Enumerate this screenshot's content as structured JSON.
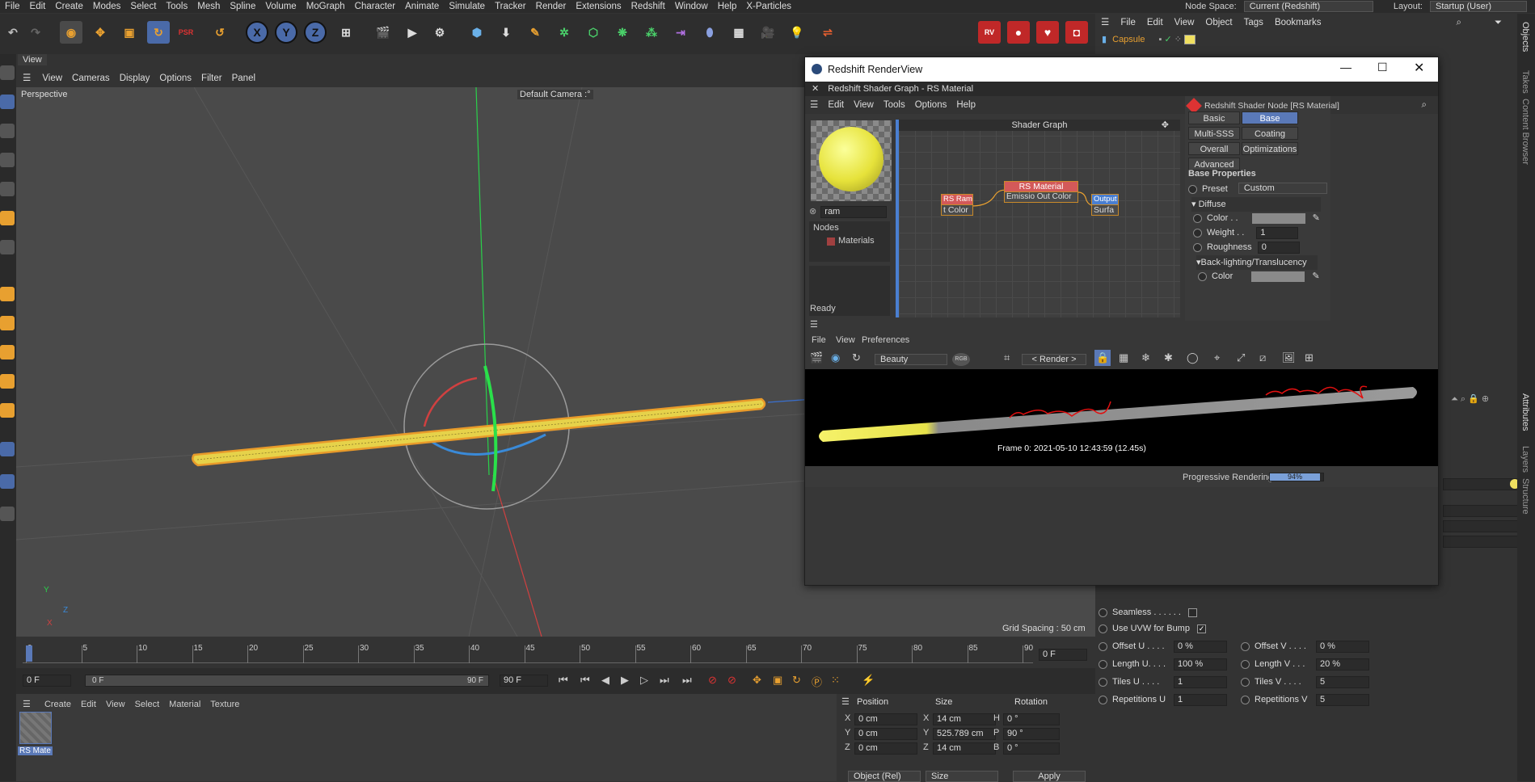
{
  "menubar": {
    "items": [
      "File",
      "Edit",
      "Create",
      "Modes",
      "Select",
      "Tools",
      "Mesh",
      "Spline",
      "Volume",
      "MoGraph",
      "Character",
      "Animate",
      "Simulate",
      "Tracker",
      "Render",
      "Extensions",
      "Redshift",
      "Window",
      "Help",
      "X-Particles"
    ],
    "node_space_label": "Node Space:",
    "node_space_value": "Current (Redshift)",
    "layout_label": "Layout:",
    "layout_value": "Startup (User)"
  },
  "toolbar": {
    "axis_x": "X",
    "axis_y": "Y",
    "axis_z": "Z"
  },
  "viewport": {
    "tab": "View",
    "menu": [
      "View",
      "Cameras",
      "Display",
      "Options",
      "Filter",
      "Panel"
    ],
    "projection": "Perspective",
    "camera": "Default Camera",
    "camera_suffix": ":°",
    "grid_spacing": "Grid Spacing : 50 cm",
    "axis_y": "Y",
    "axis_x": "X",
    "axis_z": "Z"
  },
  "timeline": {
    "ticks": [
      "0",
      "5",
      "10",
      "15",
      "20",
      "25",
      "30",
      "35",
      "40",
      "45",
      "50",
      "55",
      "60",
      "65",
      "70",
      "75",
      "80",
      "85",
      "90"
    ],
    "current_frame": "0 F",
    "start_frame": "0 F",
    "range_start": "0 F",
    "range_end": "90 F",
    "end_frame": "90 F"
  },
  "material_manager": {
    "menu": [
      "Create",
      "Edit",
      "View",
      "Select",
      "Material",
      "Texture"
    ],
    "material_name": "RS Mate"
  },
  "coordinates": {
    "headers": [
      "Position",
      "Size",
      "Rotation"
    ],
    "rows": [
      {
        "axis": "X",
        "pos": "0 cm",
        "size_axis": "X",
        "size": "14 cm",
        "rot_axis": "H",
        "rot": "0 °"
      },
      {
        "axis": "Y",
        "pos": "0 cm",
        "size_axis": "Y",
        "size": "525.789 cm",
        "rot_axis": "P",
        "rot": "90 °"
      },
      {
        "axis": "Z",
        "pos": "0 cm",
        "size_axis": "Z",
        "size": "14 cm",
        "rot_axis": "B",
        "rot": "0 °"
      }
    ],
    "mode": "Object (Rel)",
    "size_mode": "Size",
    "apply": "Apply"
  },
  "object_manager": {
    "menu": [
      "File",
      "Edit",
      "View",
      "Object",
      "Tags",
      "Bookmarks"
    ],
    "object_name": "Capsule"
  },
  "right_tabs": [
    "Objects",
    "Takes",
    "Content Browser",
    "Attributes",
    "Layers",
    "Structure"
  ],
  "attributes": {
    "seamless_label": "Seamless . . . . . .",
    "uvw_bump_label": "Use UVW for Bump",
    "uvw_bump_checked": "✓",
    "offset_u_label": "Offset U . . . .",
    "offset_u": "0 %",
    "offset_v_label": "Offset V . . . .",
    "offset_v": "0 %",
    "length_u_label": "Length U. . . .",
    "length_u": "100 %",
    "length_v_label": "Length V . . .",
    "length_v": "20 %",
    "tiles_u_label": "Tiles U . . . .",
    "tiles_u": "1",
    "tiles_v_label": "Tiles V . . . .",
    "tiles_v": "5",
    "rep_u_label": "Repetitions U",
    "rep_u": "1",
    "rep_v_label": "Repetitions V",
    "rep_v": "5"
  },
  "renderview": {
    "title": "Redshift RenderView",
    "shader_subtitle": "Redshift Shader Graph - RS Material",
    "menu": [
      "Edit",
      "View",
      "Tools",
      "Options",
      "Help"
    ],
    "search_value": "ram",
    "nodes_label": "Nodes",
    "materials_label": "Materials",
    "graph_title": "Shader Graph",
    "node_ramp": "RS Ramp",
    "node_ramp_port": "t Color",
    "node_material": "RS Material",
    "node_material_ports": "Emissio Out Color",
    "node_output": "Output",
    "node_output_port": "Surfa",
    "props_title": "Redshift Shader Node [RS Material]",
    "tabs": [
      "Basic",
      "Base Properties",
      "Multi-SSS",
      "Coating",
      "Overall",
      "Optimizations",
      "Advanced"
    ],
    "section": "Base Properties",
    "preset_label": "Preset",
    "preset_value": "Custom",
    "diffuse_label": "Diffuse",
    "color_label": "Color . .",
    "weight_label": "Weight . .",
    "weight_value": "1",
    "roughness_label": "Roughness",
    "roughness_value": "0",
    "backlight_label": "Back-lighting/Translucency",
    "bl_color_label": "Color",
    "status": "Ready",
    "menu2": [
      "File",
      "View",
      "Preferences"
    ],
    "aov": "Beauty",
    "rgb": "RGB",
    "render_target": "< Render >",
    "frame_info": "Frame 0:  2021-05-10  12:43:59  (12.45s)",
    "progress_label": "Progressive Rendering...",
    "progress_text": "94%",
    "progress": 0.94
  },
  "colors": {
    "accent": "#5a79b8",
    "capsule": "#e6d24a",
    "selection": "#e89a2a"
  }
}
